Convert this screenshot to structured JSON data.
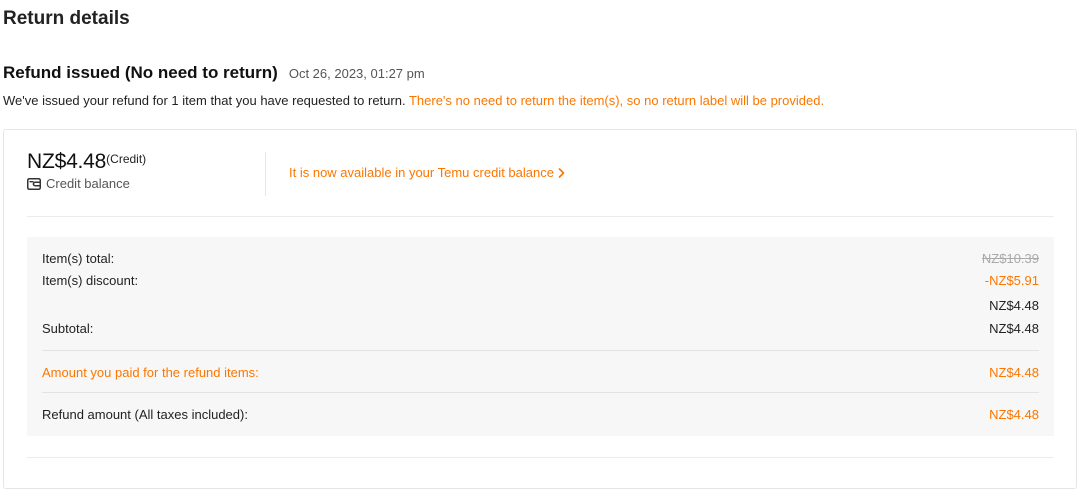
{
  "page_title": "Return details",
  "status": {
    "title": "Refund issued (No need to return)",
    "date": "Oct 26, 2023, 01:27 pm",
    "message": "We've issued your refund for 1 item that you have requested to return.",
    "note": "There's no need to return the item(s), so no return label will be provided."
  },
  "refund": {
    "amount": "NZ$4.48",
    "amount_tag": "(Credit)",
    "method": "Credit balance",
    "method_icon": "wallet-icon",
    "credit_link": "It is now available in your Temu credit balance"
  },
  "summary": {
    "items_total_label": "Item(s) total:",
    "items_total_value": "NZ$10.39",
    "items_discount_label": "Item(s) discount:",
    "items_discount_value": "-NZ$5.91",
    "after_discount_value": "NZ$4.48",
    "subtotal_label": "Subtotal:",
    "subtotal_value": "NZ$4.48",
    "paid_label": "Amount you paid for the refund items:",
    "paid_value": "NZ$4.48",
    "refund_label": "Refund amount (All taxes included):",
    "refund_value": "NZ$4.48"
  },
  "colors": {
    "accent": "#fb7701",
    "text": "#222222",
    "muted": "#555555",
    "panel": "#f7f7f7"
  }
}
